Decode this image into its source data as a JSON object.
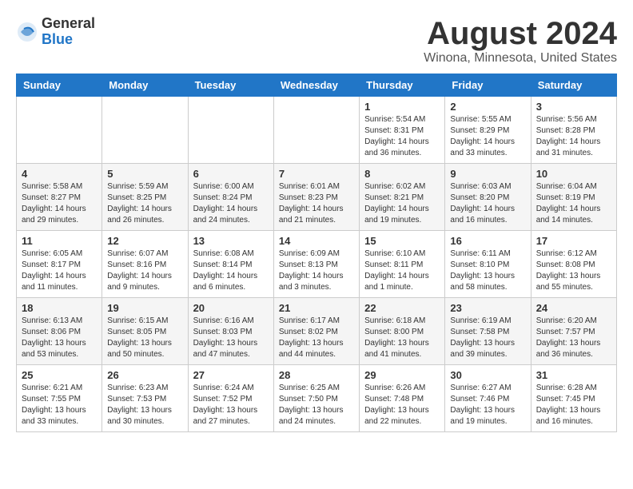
{
  "header": {
    "logo_general": "General",
    "logo_blue": "Blue",
    "title": "August 2024",
    "subtitle": "Winona, Minnesota, United States"
  },
  "weekdays": [
    "Sunday",
    "Monday",
    "Tuesday",
    "Wednesday",
    "Thursday",
    "Friday",
    "Saturday"
  ],
  "weeks": [
    [
      {
        "day": "",
        "info": ""
      },
      {
        "day": "",
        "info": ""
      },
      {
        "day": "",
        "info": ""
      },
      {
        "day": "",
        "info": ""
      },
      {
        "day": "1",
        "info": "Sunrise: 5:54 AM\nSunset: 8:31 PM\nDaylight: 14 hours and 36 minutes."
      },
      {
        "day": "2",
        "info": "Sunrise: 5:55 AM\nSunset: 8:29 PM\nDaylight: 14 hours and 33 minutes."
      },
      {
        "day": "3",
        "info": "Sunrise: 5:56 AM\nSunset: 8:28 PM\nDaylight: 14 hours and 31 minutes."
      }
    ],
    [
      {
        "day": "4",
        "info": "Sunrise: 5:58 AM\nSunset: 8:27 PM\nDaylight: 14 hours and 29 minutes."
      },
      {
        "day": "5",
        "info": "Sunrise: 5:59 AM\nSunset: 8:25 PM\nDaylight: 14 hours and 26 minutes."
      },
      {
        "day": "6",
        "info": "Sunrise: 6:00 AM\nSunset: 8:24 PM\nDaylight: 14 hours and 24 minutes."
      },
      {
        "day": "7",
        "info": "Sunrise: 6:01 AM\nSunset: 8:23 PM\nDaylight: 14 hours and 21 minutes."
      },
      {
        "day": "8",
        "info": "Sunrise: 6:02 AM\nSunset: 8:21 PM\nDaylight: 14 hours and 19 minutes."
      },
      {
        "day": "9",
        "info": "Sunrise: 6:03 AM\nSunset: 8:20 PM\nDaylight: 14 hours and 16 minutes."
      },
      {
        "day": "10",
        "info": "Sunrise: 6:04 AM\nSunset: 8:19 PM\nDaylight: 14 hours and 14 minutes."
      }
    ],
    [
      {
        "day": "11",
        "info": "Sunrise: 6:05 AM\nSunset: 8:17 PM\nDaylight: 14 hours and 11 minutes."
      },
      {
        "day": "12",
        "info": "Sunrise: 6:07 AM\nSunset: 8:16 PM\nDaylight: 14 hours and 9 minutes."
      },
      {
        "day": "13",
        "info": "Sunrise: 6:08 AM\nSunset: 8:14 PM\nDaylight: 14 hours and 6 minutes."
      },
      {
        "day": "14",
        "info": "Sunrise: 6:09 AM\nSunset: 8:13 PM\nDaylight: 14 hours and 3 minutes."
      },
      {
        "day": "15",
        "info": "Sunrise: 6:10 AM\nSunset: 8:11 PM\nDaylight: 14 hours and 1 minute."
      },
      {
        "day": "16",
        "info": "Sunrise: 6:11 AM\nSunset: 8:10 PM\nDaylight: 13 hours and 58 minutes."
      },
      {
        "day": "17",
        "info": "Sunrise: 6:12 AM\nSunset: 8:08 PM\nDaylight: 13 hours and 55 minutes."
      }
    ],
    [
      {
        "day": "18",
        "info": "Sunrise: 6:13 AM\nSunset: 8:06 PM\nDaylight: 13 hours and 53 minutes."
      },
      {
        "day": "19",
        "info": "Sunrise: 6:15 AM\nSunset: 8:05 PM\nDaylight: 13 hours and 50 minutes."
      },
      {
        "day": "20",
        "info": "Sunrise: 6:16 AM\nSunset: 8:03 PM\nDaylight: 13 hours and 47 minutes."
      },
      {
        "day": "21",
        "info": "Sunrise: 6:17 AM\nSunset: 8:02 PM\nDaylight: 13 hours and 44 minutes."
      },
      {
        "day": "22",
        "info": "Sunrise: 6:18 AM\nSunset: 8:00 PM\nDaylight: 13 hours and 41 minutes."
      },
      {
        "day": "23",
        "info": "Sunrise: 6:19 AM\nSunset: 7:58 PM\nDaylight: 13 hours and 39 minutes."
      },
      {
        "day": "24",
        "info": "Sunrise: 6:20 AM\nSunset: 7:57 PM\nDaylight: 13 hours and 36 minutes."
      }
    ],
    [
      {
        "day": "25",
        "info": "Sunrise: 6:21 AM\nSunset: 7:55 PM\nDaylight: 13 hours and 33 minutes."
      },
      {
        "day": "26",
        "info": "Sunrise: 6:23 AM\nSunset: 7:53 PM\nDaylight: 13 hours and 30 minutes."
      },
      {
        "day": "27",
        "info": "Sunrise: 6:24 AM\nSunset: 7:52 PM\nDaylight: 13 hours and 27 minutes."
      },
      {
        "day": "28",
        "info": "Sunrise: 6:25 AM\nSunset: 7:50 PM\nDaylight: 13 hours and 24 minutes."
      },
      {
        "day": "29",
        "info": "Sunrise: 6:26 AM\nSunset: 7:48 PM\nDaylight: 13 hours and 22 minutes."
      },
      {
        "day": "30",
        "info": "Sunrise: 6:27 AM\nSunset: 7:46 PM\nDaylight: 13 hours and 19 minutes."
      },
      {
        "day": "31",
        "info": "Sunrise: 6:28 AM\nSunset: 7:45 PM\nDaylight: 13 hours and 16 minutes."
      }
    ]
  ]
}
